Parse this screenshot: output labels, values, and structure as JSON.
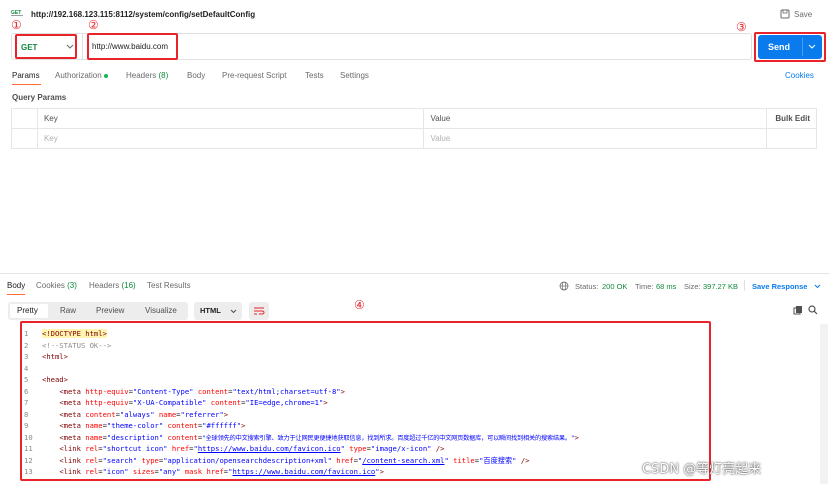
{
  "header": {
    "url": "http://192.168.123.115:8112/system/config/setDefaultConfig",
    "save_label": "Save"
  },
  "request": {
    "method": "GET",
    "url_value": "http://www.baidu.com",
    "send_label": "Send"
  },
  "annotations": {
    "n1": "①",
    "n2": "②",
    "n3": "③",
    "n4": "④"
  },
  "request_tabs": {
    "params": "Params",
    "authorization": "Authorization",
    "headers": "Headers",
    "headers_count": "(8)",
    "body": "Body",
    "prerequest": "Pre-request Script",
    "tests": "Tests",
    "settings": "Settings",
    "cookies": "Cookies"
  },
  "query_params": {
    "title": "Query Params",
    "col_key": "Key",
    "col_value": "Value",
    "bulk_edit": "Bulk Edit",
    "key_placeholder": "Key",
    "value_placeholder": "Value"
  },
  "response_tabs": {
    "body": "Body",
    "cookies": "Cookies",
    "cookies_count": "(3)",
    "headers": "Headers",
    "headers_count": "(16)",
    "test_results": "Test Results"
  },
  "response_status": {
    "status_label": "Status:",
    "status_value": "200 OK",
    "time_label": "Time:",
    "time_value": "68 ms",
    "size_label": "Size:",
    "size_value": "397.27 KB",
    "save_response": "Save Response"
  },
  "view_tabs": {
    "pretty": "Pretty",
    "raw": "Raw",
    "preview": "Preview",
    "visualize": "Visualize",
    "format": "HTML"
  },
  "code": {
    "l1a": "<!DOCTYPE html>",
    "l2a": "<!--STATUS OK-->",
    "l3a": "<html>",
    "l5a": "<head>",
    "l6_attr1": "http-equiv",
    "l6_val1": "\"Content-Type\"",
    "l6_attr2": "content",
    "l6_val2": "\"text/html;charset=utf-8\"",
    "l7_attr1": "http-equiv",
    "l7_val1": "\"X-UA-Compatible\"",
    "l7_attr2": "content",
    "l7_val2": "\"IE=edge,chrome=1\"",
    "l8_attr1": "content",
    "l8_val1": "\"always\"",
    "l8_attr2": "name",
    "l8_val2": "\"referrer\"",
    "l9_attr1": "name",
    "l9_val1": "\"theme-color\"",
    "l9_attr2": "content",
    "l9_val2": "\"#ffffff\"",
    "l10_attr1": "name",
    "l10_val1": "\"description\"",
    "l10_attr2": "content",
    "l10_val2": "\"全球领先的中文搜索引擎、致力于让网民更便捷地获取信息，找到所求。百度超过千亿的中文网页数据库，可以瞬间找到相关的搜索结果。\"",
    "l11_attr1": "rel",
    "l11_val1": "\"shortcut icon\"",
    "l11_attr2": "href",
    "l11_url": "https://www.baidu.com/favicon.ico",
    "l11_attr3": "type",
    "l11_val3": "\"image/x-icon\"",
    "l12_attr1": "rel",
    "l12_val1": "\"search\"",
    "l12_attr2": "type",
    "l12_val2": "\"application/opensearchdescription+xml\"",
    "l12_attr3": "href",
    "l12_url": "/content-search.xml",
    "l12_attr4": "title",
    "l12_val4": "\"百度搜索\"",
    "l13_attr1": "rel",
    "l13_val1": "\"icon\"",
    "l13_attr2": "sizes",
    "l13_val2": "\"any\"",
    "l13_attr3": "mask",
    "l13_attr4": "href",
    "l13_url": "https://www.baidu.com/favicon.ico"
  },
  "watermark": "CSDN @等灯亮起来"
}
